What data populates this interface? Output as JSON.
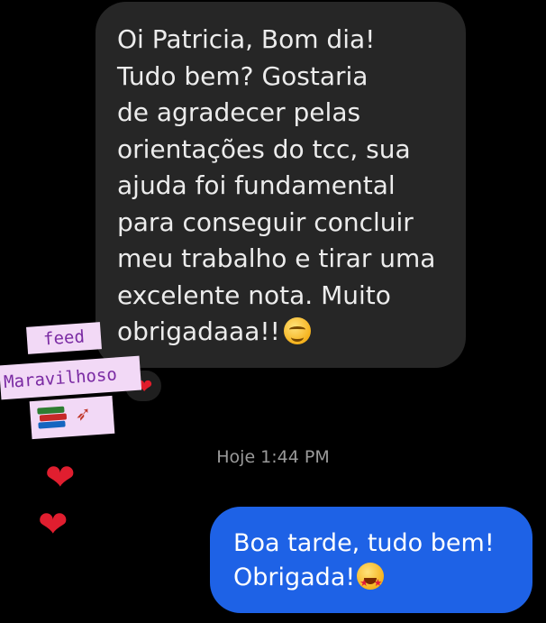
{
  "incoming_message": {
    "lines": [
      "Oi Patricia, Bom dia!",
      "Tudo bem? Gostaria",
      "de agradecer pelas",
      "orientações do tcc, sua",
      "ajuda foi fundamental",
      "para conseguir concluir",
      "meu trabalho e tirar uma",
      "excelente nota. Muito",
      "obrigadaaa!!"
    ],
    "emoji": "smiling-face-icon",
    "reaction": "heart-icon",
    "colors": {
      "bubble": "#262626",
      "text": "#ececec"
    }
  },
  "timestamp": "Hoje 1:44 PM",
  "outgoing_message": {
    "lines": [
      "Boa tarde, tudo bem!",
      "Obrigada!"
    ],
    "emoji": "star-struck-icon",
    "colors": {
      "bubble": "#1e62e6",
      "text": "#ffffff"
    }
  },
  "sticker": {
    "word1": "feed",
    "word2": "Maravilhoso",
    "icons": [
      "books-icon",
      "rocket-icon"
    ],
    "colors": {
      "background": "#f2d9f6",
      "text": "#7a2aa3"
    }
  },
  "decorations": {
    "hearts": [
      "heart-icon",
      "heart-icon"
    ],
    "heart_color": "#e01e2f"
  }
}
